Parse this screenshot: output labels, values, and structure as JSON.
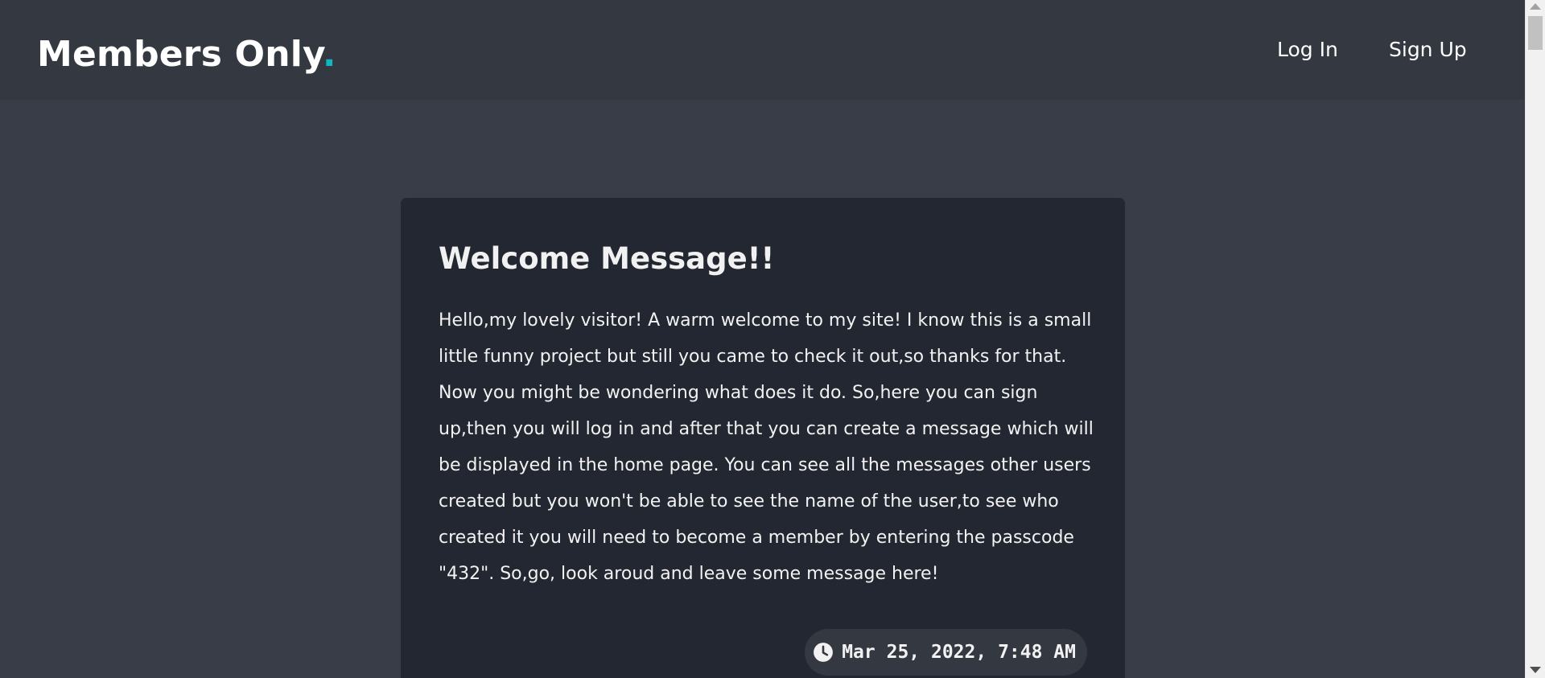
{
  "navbar": {
    "logo_text": "Members Only",
    "logo_dot": ".",
    "accent_color": "#10b7c3",
    "links": [
      {
        "label": "Log In"
      },
      {
        "label": "Sign Up"
      }
    ]
  },
  "message": {
    "title": "Welcome Message!!",
    "body": "Hello,my lovely visitor! A warm welcome to my site! I know this is a small little funny project but still you came to check it out,so thanks for that. Now you might be wondering what does it do. So,here you can sign up,then you will log in and after that you can create a message which will be displayed in the home page. You can see all the messages other users created but you won't be able to see the name of the user,to see who created it you will need to become a member by entering the passcode \"432\". So,go, look aroud and leave some message here!",
    "timestamp": "Mar 25, 2022, 7:48 AM",
    "timestamp_icon": "clock-icon"
  },
  "colors": {
    "page_background": "#393d47",
    "navbar_background": "#343841",
    "card_background": "#232731"
  }
}
